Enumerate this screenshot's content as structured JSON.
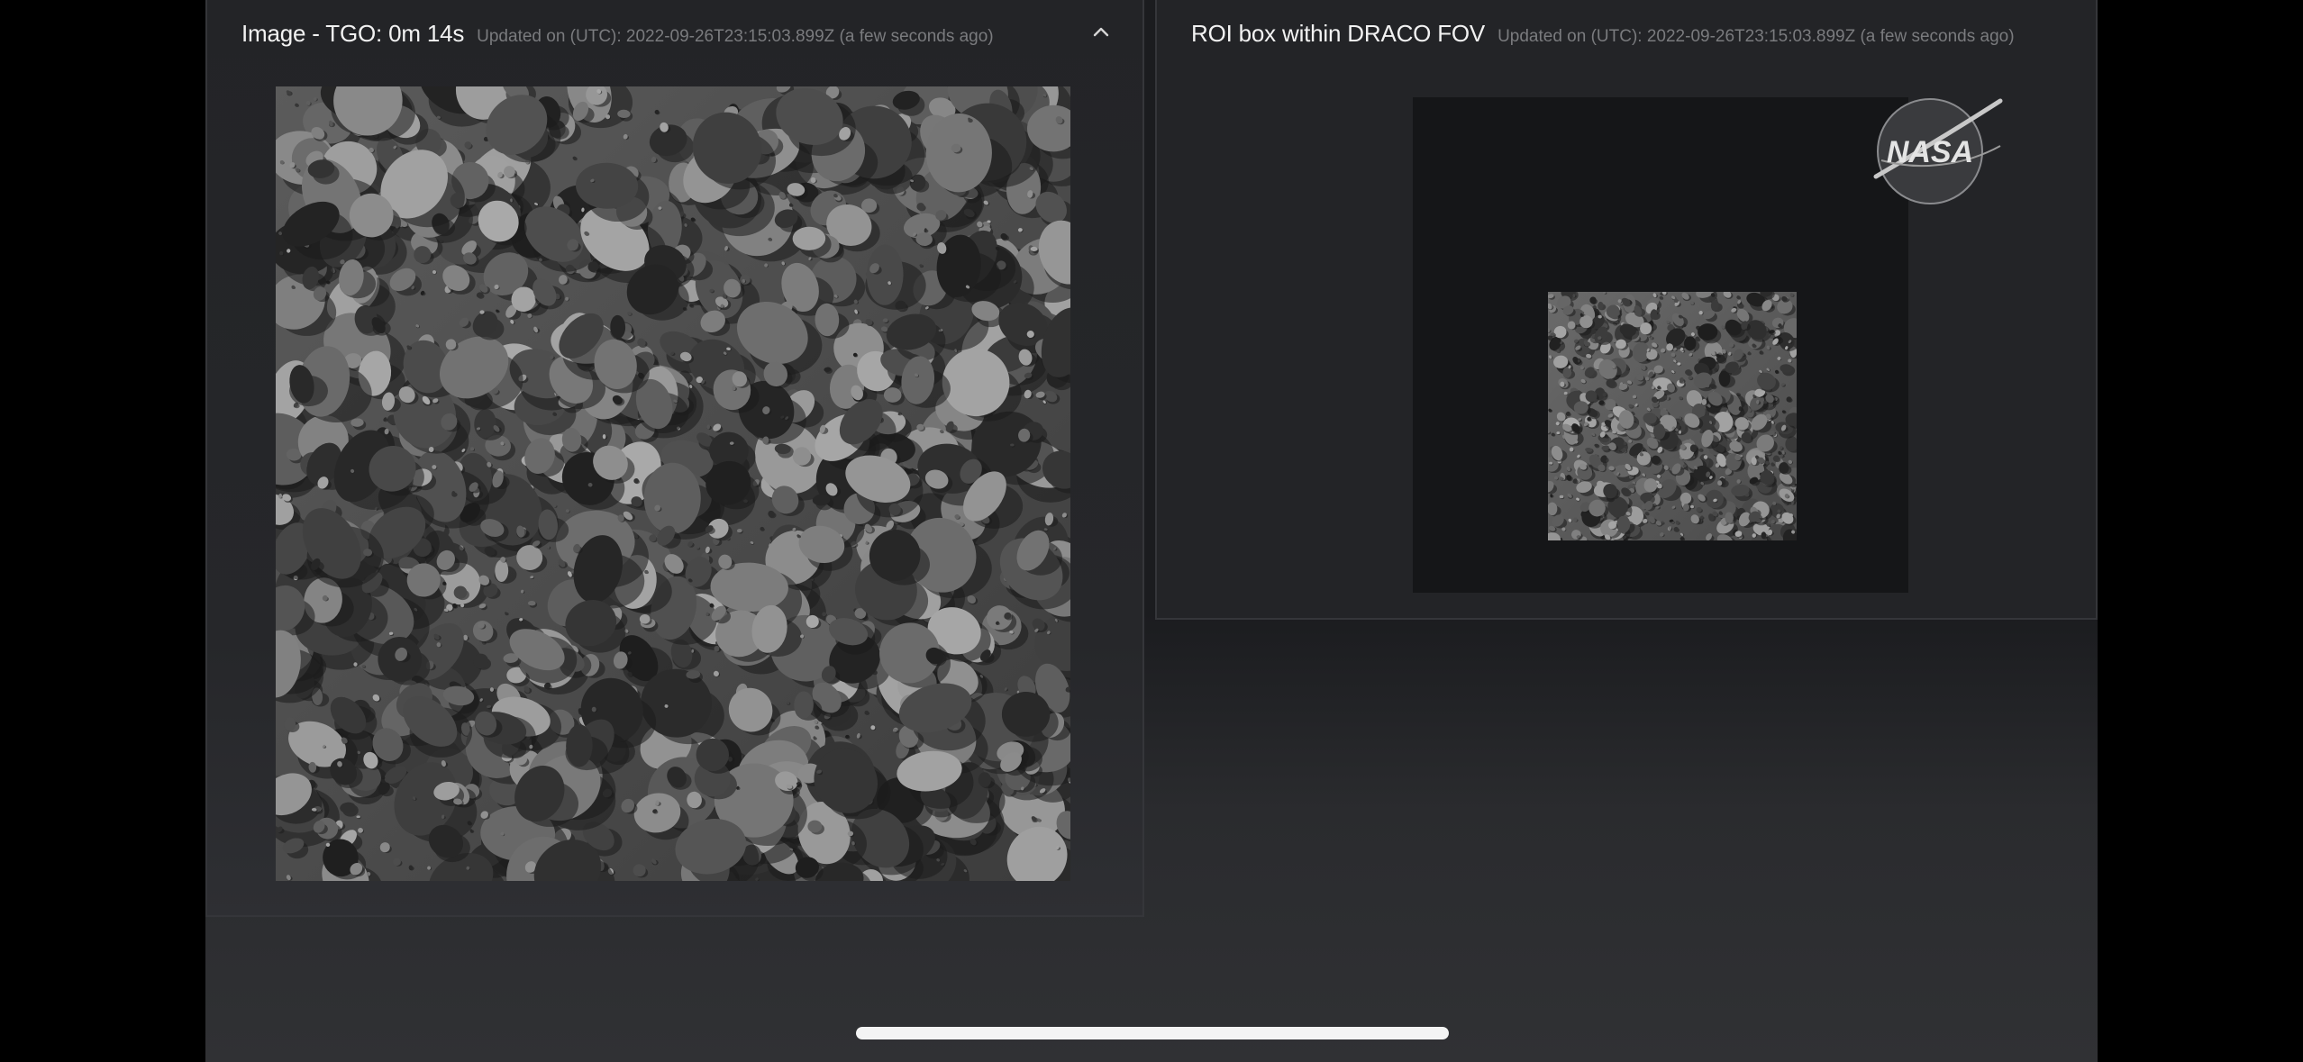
{
  "left_panel": {
    "title": "Image - TGO: 0m 14s",
    "updated": "Updated on (UTC): 2022-09-26T23:15:03.899Z (a few seconds ago)",
    "collapse_icon": "chevron-up-icon",
    "image_alt": "asteroid-surface-image"
  },
  "right_panel": {
    "title": "ROI box within DRACO FOV",
    "updated": "Updated on (UTC): 2022-09-26T23:15:03.899Z (a few seconds ago)",
    "logo_icon": "nasa-logo",
    "logo_text": "NASA",
    "roi_image_alt": "roi-surface-image"
  },
  "colors": {
    "background": "#000000",
    "panel": "#242528",
    "title_text": "#f2f2f2",
    "updated_text": "#7a7b7e",
    "home_indicator": "#f4f4f4"
  }
}
